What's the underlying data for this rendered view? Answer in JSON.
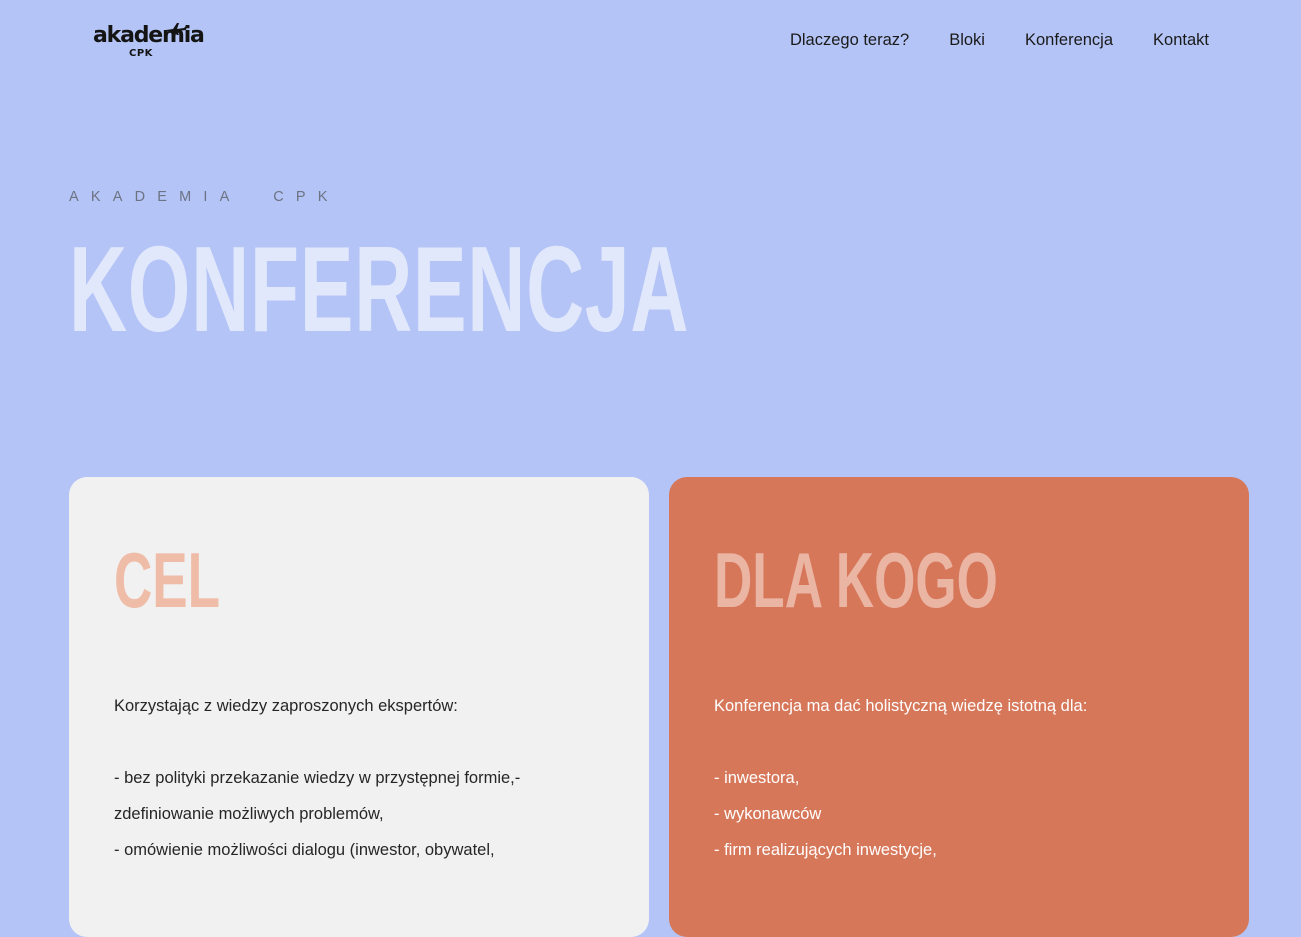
{
  "header": {
    "logo": {
      "word": "akademia",
      "sub": "CPK",
      "icon": "airplane-icon"
    },
    "nav": [
      {
        "label": "Dlaczego teraz?"
      },
      {
        "label": "Bloki"
      },
      {
        "label": "Konferencja"
      },
      {
        "label": "Kontakt"
      }
    ]
  },
  "hero": {
    "eyebrow": "AKADEMIA  CPK",
    "title": "KONFERENCJA"
  },
  "cards": {
    "cel": {
      "title": "CEL",
      "intro": "Korzystając z wiedzy zaproszonych ekspertów:",
      "lines": [
        "- bez polityki przekazanie wiedzy w przystępnej formie,-",
        "zdefiniowanie możliwych problemów,",
        "- omówienie możliwości dialogu (inwestor, obywatel,"
      ]
    },
    "dla": {
      "title": "DLA KOGO",
      "intro": "Konferencja ma dać holistyczną wiedzę istotną dla:",
      "lines": [
        "- inwestora,",
        "- wykonawców",
        "- firm realizujących inwestycje,"
      ]
    }
  },
  "colors": {
    "background": "#b4c4f6",
    "hero_title": "#e2e8fb",
    "card_cel_bg": "#f1f1f1",
    "card_dla_bg": "#d7775a",
    "card_cel_title": "#efbca8",
    "card_dla_title": "#ebb5a4"
  }
}
